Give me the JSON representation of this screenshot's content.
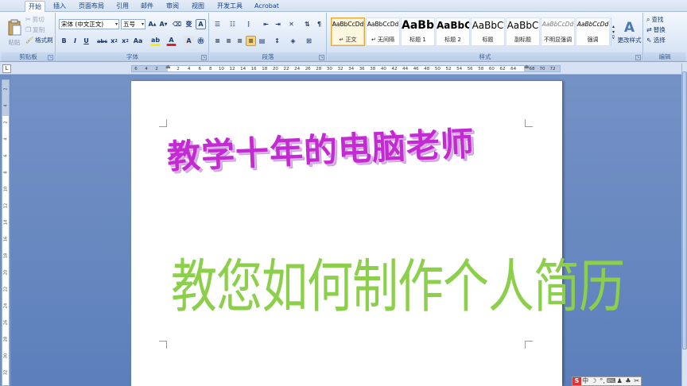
{
  "tabs": [
    "开始",
    "插入",
    "页面布局",
    "引用",
    "邮件",
    "审阅",
    "视图",
    "开发工具",
    "Acrobat"
  ],
  "clipboard": {
    "paste_label": "粘贴",
    "cut_label": "剪切",
    "copy_label": "复制",
    "format_painter_label": "格式刷",
    "group_label": "剪贴板"
  },
  "font": {
    "font_name": "宋体 (中文正文)",
    "font_size": "五号",
    "group_label": "字体"
  },
  "paragraph": {
    "group_label": "段落"
  },
  "styles": {
    "group_label": "样式",
    "items": [
      {
        "sample": "AaBbCcDd",
        "name": "↵ 正文"
      },
      {
        "sample": "AaBbCcDd",
        "name": "↵ 无间隔"
      },
      {
        "sample": "AaBb",
        "name": "标题 1"
      },
      {
        "sample": "AaBbC",
        "name": "标题 2"
      },
      {
        "sample": "AaBbC",
        "name": "标题"
      },
      {
        "sample": "AaBbC",
        "name": "副标题"
      },
      {
        "sample": "AaBbCcDd",
        "name": "不明显强调"
      },
      {
        "sample": "AaBbCcDd",
        "name": "强调"
      }
    ],
    "change_styles_label": "更改样式"
  },
  "editing": {
    "find_label": "查找",
    "replace_label": "替换",
    "select_label": "选择",
    "group_label": "编辑"
  },
  "ruler": {
    "left_ticks": [
      "6",
      "4",
      "2"
    ],
    "ticks": [
      "2",
      "4",
      "6",
      "8",
      "10",
      "12",
      "14",
      "16",
      "18",
      "20",
      "22",
      "24",
      "26",
      "28",
      "30",
      "32",
      "34",
      "36",
      "38",
      "40",
      "42",
      "44",
      "46",
      "48",
      "50",
      "52",
      "54",
      "56",
      "58",
      "60",
      "62",
      "64"
    ],
    "right_ticks": [
      "68",
      "70",
      "72"
    ]
  },
  "vertical_ruler": {
    "ticks": [
      "2",
      "4",
      "2",
      "4",
      "6",
      "8",
      "10",
      "12",
      "14",
      "16",
      "18",
      "20",
      "22",
      "24",
      "26",
      "28",
      "30",
      "32"
    ]
  },
  "document": {
    "title_text": "教学十年的电脑老师",
    "subtitle_text": "教您如何制作个人简历",
    "title_color": "#c42ad2",
    "subtitle_color": "#8ccf4a"
  },
  "ime_bar": [
    "S",
    "中",
    "☽",
    "°,",
    "⌨",
    "♟",
    "♣",
    "✂"
  ]
}
